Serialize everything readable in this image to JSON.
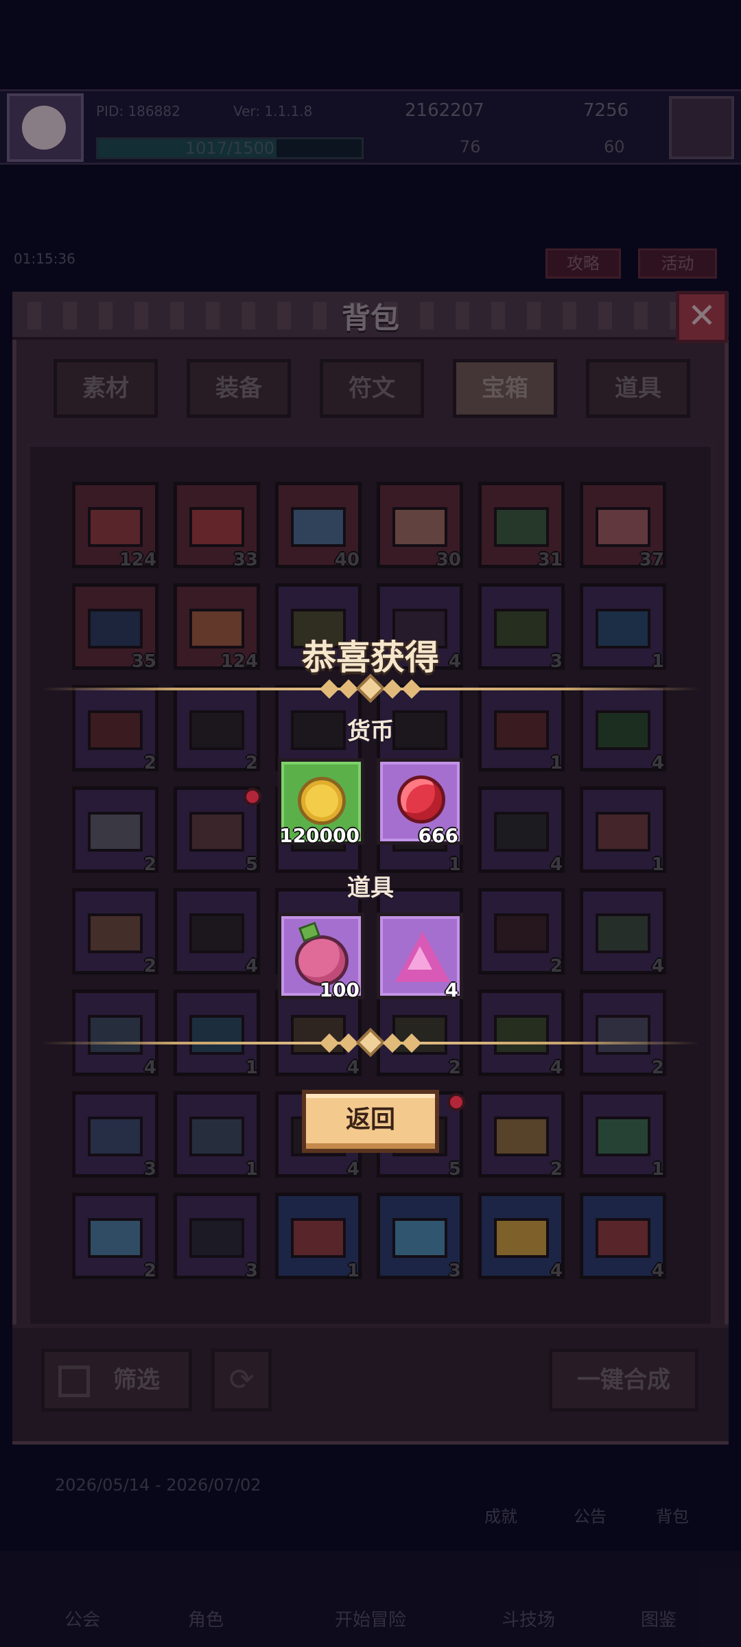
{
  "hud": {
    "pid": "PID: 186882",
    "version": "Ver: 1.1.1.8",
    "gold": "2162207",
    "gems": "7256",
    "xp": "1017/1500",
    "xp_fraction": 0.678,
    "stat_a": "76",
    "stat_b": "60",
    "timer": "01:15:36",
    "guide_label": "攻略",
    "event_label": "活动",
    "date_range": "2026/05/14 - 2026/07/02"
  },
  "side_icons": {
    "achievement": "成就",
    "notice": "公告",
    "backpack": "背包"
  },
  "bottom_nav": {
    "guild": "公会",
    "character": "角色",
    "adventure": "开始冒险",
    "arena": "斗技场",
    "codex": "图鉴"
  },
  "backpack": {
    "title": "背包",
    "tabs": [
      {
        "label": "素材",
        "active": false
      },
      {
        "label": "装备",
        "active": false
      },
      {
        "label": "符文",
        "active": false
      },
      {
        "label": "宝箱",
        "active": true
      },
      {
        "label": "道具",
        "active": false
      }
    ],
    "rows": [
      [
        {
          "count": "124",
          "bg": "#5a2a34",
          "chest": "#8a3a3c"
        },
        {
          "count": "33",
          "bg": "#5a2a34",
          "chest": "#9a3a3c"
        },
        {
          "count": "40",
          "bg": "#5a2a34",
          "chest": "#4a6a8a"
        },
        {
          "count": "30",
          "bg": "#5a2a34",
          "chest": "#9a6a5c"
        },
        {
          "count": "31",
          "bg": "#5a2a34",
          "chest": "#3a5a3c"
        },
        {
          "count": "37",
          "bg": "#5a2a34",
          "chest": "#9a5a5c"
        }
      ],
      [
        {
          "count": "35",
          "bg": "#5a2a34",
          "chest": "#2a3a5a"
        },
        {
          "count": "124",
          "bg": "#5a2a34",
          "chest": "#9a5a3c"
        },
        {
          "count": "",
          "bg": "#3e2a52",
          "chest": "#4a4a2c"
        },
        {
          "count": "4",
          "bg": "#3e2a52",
          "chest": "#3a2a3c"
        },
        {
          "count": "3",
          "bg": "#3e2a52",
          "chest": "#3a4a2c"
        },
        {
          "count": "1",
          "bg": "#3e2a52",
          "chest": "#2a4a6a"
        }
      ],
      [
        {
          "count": "2",
          "bg": "#3e2a52",
          "chest": "#5a2a2c"
        },
        {
          "count": "2",
          "bg": "#3e2a52",
          "chest": "#2a2228"
        },
        {
          "count": "",
          "bg": "#3e2a52",
          "chest": "#2a2228"
        },
        {
          "count": "",
          "bg": "#3e2a52",
          "chest": "#2a2228"
        },
        {
          "count": "1",
          "bg": "#3e2a52",
          "chest": "#5a2a2c"
        },
        {
          "count": "4",
          "bg": "#3e2a52",
          "chest": "#2a4a2c"
        }
      ],
      [
        {
          "count": "2",
          "bg": "#3e2a52",
          "chest": "#5a5a64"
        },
        {
          "count": "5",
          "bg": "#3e2a52",
          "chest": "#5a3a3c"
        },
        {
          "count": "",
          "bg": "#3e2a52",
          "chest": "#2a2228"
        },
        {
          "count": "1",
          "bg": "#3e2a52",
          "chest": "#2a2228"
        },
        {
          "count": "4",
          "bg": "#3e2a52",
          "chest": "#2a2a2c"
        },
        {
          "count": "1",
          "bg": "#3e2a52",
          "chest": "#6a3a3c"
        }
      ],
      [
        {
          "count": "2",
          "bg": "#3e2a52",
          "chest": "#6a4a3c"
        },
        {
          "count": "4",
          "bg": "#3e2a52",
          "chest": "#2a2228"
        },
        {
          "count": "",
          "bg": "#3e2a52",
          "chest": "#2a2228"
        },
        {
          "count": "",
          "bg": "#3e2a52",
          "chest": "#2a2228"
        },
        {
          "count": "2",
          "bg": "#3e2a52",
          "chest": "#3a2228"
        },
        {
          "count": "4",
          "bg": "#3e2a52",
          "chest": "#3a4a3c"
        }
      ],
      [
        {
          "count": "4",
          "bg": "#3e2a52",
          "chest": "#3a4a5c"
        },
        {
          "count": "1",
          "bg": "#3e2a52",
          "chest": "#2a4a5c"
        },
        {
          "count": "4",
          "bg": "#3e2a52",
          "chest": "#4a3a2c"
        },
        {
          "count": "2",
          "bg": "#3e2a52",
          "chest": "#3a3a2c"
        },
        {
          "count": "4",
          "bg": "#3e2a52",
          "chest": "#3a4a2c"
        },
        {
          "count": "2",
          "bg": "#3e2a52",
          "chest": "#4a4a5c"
        }
      ],
      [
        {
          "count": "3",
          "bg": "#3e2a52",
          "chest": "#3a4a6a"
        },
        {
          "count": "1",
          "bg": "#3e2a52",
          "chest": "#3a4a5c"
        },
        {
          "count": "4",
          "bg": "#3e2a52",
          "chest": "#2a2228"
        },
        {
          "count": "5",
          "bg": "#3e2a52",
          "chest": "#2a2228"
        },
        {
          "count": "2",
          "bg": "#3e2a52",
          "chest": "#8a6a3c"
        },
        {
          "count": "1",
          "bg": "#3e2a52",
          "chest": "#3a6a4c"
        }
      ],
      [
        {
          "count": "2",
          "bg": "#3e2a52",
          "chest": "#4a7a9a"
        },
        {
          "count": "3",
          "bg": "#3e2a52",
          "chest": "#2a2a34"
        },
        {
          "count": "1",
          "bg": "#2a3a6a",
          "chest": "#8a3a3c"
        },
        {
          "count": "3",
          "bg": "#2a3a6a",
          "chest": "#4a8aaa"
        },
        {
          "count": "4",
          "bg": "#2a3a6a",
          "chest": "#c89a3c"
        },
        {
          "count": "4",
          "bg": "#2a3a6a",
          "chest": "#8a3a3c"
        }
      ]
    ],
    "filter_label": "筛选",
    "merge_label": "一键合成"
  },
  "reward_popup": {
    "title": "恭喜获得",
    "currency_label": "货币",
    "items_label": "道具",
    "currency": [
      {
        "icon": "gold-coin-icon",
        "count": "120000",
        "frame": "green"
      },
      {
        "icon": "ruby-gem-icon",
        "count": "666",
        "frame": "purple"
      }
    ],
    "items": [
      {
        "icon": "pink-fruit-icon",
        "count": "100",
        "frame": "purple"
      },
      {
        "icon": "pink-crystal-icon",
        "count": "4",
        "frame": "purple"
      }
    ],
    "back_label": "返回"
  }
}
